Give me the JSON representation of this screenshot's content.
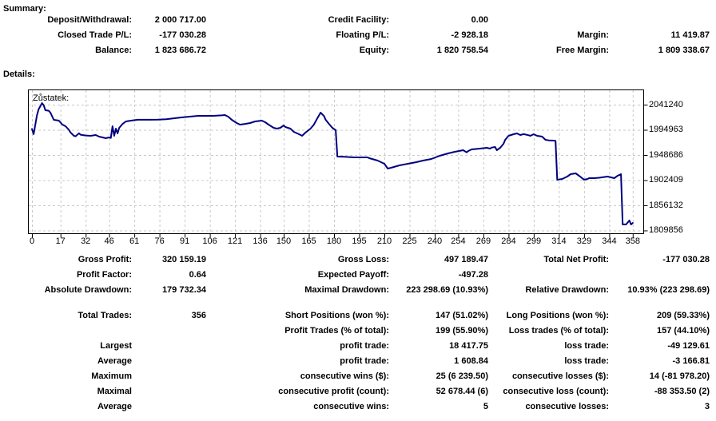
{
  "summary": {
    "heading": "Summary:",
    "rows": [
      {
        "c1l": "Deposit/Withdrawal:",
        "c1v": "2 000 717.00",
        "c2l": "Credit Facility:",
        "c2v": "0.00",
        "c3l": "",
        "c3v": ""
      },
      {
        "c1l": "Closed Trade P/L:",
        "c1v": "-177 030.28",
        "c2l": "Floating P/L:",
        "c2v": "-2 928.18",
        "c3l": "Margin:",
        "c3v": "11 419.87"
      },
      {
        "c1l": "Balance:",
        "c1v": "1 823 686.72",
        "c2l": "Equity:",
        "c2v": "1 820 758.54",
        "c3l": "Free Margin:",
        "c3v": "1 809 338.67"
      }
    ]
  },
  "details": {
    "heading": "Details:",
    "stat_groups": [
      [
        {
          "c1l": "Gross Profit:",
          "c1v": "320 159.19",
          "c2l": "Gross Loss:",
          "c2v": "497 189.47",
          "c3l": "Total Net Profit:",
          "c3v": "-177 030.28"
        },
        {
          "c1l": "Profit Factor:",
          "c1v": "0.64",
          "c2l": "Expected Payoff:",
          "c2v": "-497.28",
          "c3l": "",
          "c3v": ""
        },
        {
          "c1l": "Absolute Drawdown:",
          "c1v": "179 732.34",
          "c2l": "Maximal Drawdown:",
          "c2v": "223 298.69 (10.93%)",
          "c3l": "Relative Drawdown:",
          "c3v": "10.93% (223 298.69)"
        }
      ],
      [
        {
          "c1l": "Total Trades:",
          "c1v": "356",
          "c2l": "Short Positions (won %):",
          "c2v": "147 (51.02%)",
          "c3l": "Long Positions (won %):",
          "c3v": "209 (59.33%)"
        },
        {
          "c1l": "",
          "c1v": "",
          "c2l": "Profit Trades (% of total):",
          "c2v": "199 (55.90%)",
          "c3l": "Loss trades (% of total):",
          "c3v": "157 (44.10%)"
        },
        {
          "c1l": "Largest",
          "c1v": "",
          "c2l": "profit trade:",
          "c2v": "18 417.75",
          "c3l": "loss trade:",
          "c3v": "-49 129.61"
        },
        {
          "c1l": "Average",
          "c1v": "",
          "c2l": "profit trade:",
          "c2v": "1 608.84",
          "c3l": "loss trade:",
          "c3v": "-3 166.81"
        },
        {
          "c1l": "Maximum",
          "c1v": "",
          "c2l": "consecutive wins ($):",
          "c2v": "25 (6 239.50)",
          "c3l": "consecutive losses ($):",
          "c3v": "14 (-81 978.20)"
        },
        {
          "c1l": "Maximal",
          "c1v": "",
          "c2l": "consecutive profit (count):",
          "c2v": "52 678.44 (6)",
          "c3l": "consecutive loss (count):",
          "c3v": "-88 353.50 (2)"
        },
        {
          "c1l": "Average",
          "c1v": "",
          "c2l": "consecutive wins:",
          "c2v": "5",
          "c3l": "consecutive losses:",
          "c3v": "3"
        }
      ]
    ]
  },
  "chart_data": {
    "type": "line",
    "title": "Zůstatek:",
    "series_name": "Balance",
    "line_color": "#000080",
    "grid_color": "#c9c9c9",
    "frame_color": "#000000",
    "legend_position": "none",
    "grid": true,
    "xlabel": "",
    "ylabel": "",
    "x_ticks": [
      0,
      17,
      32,
      46,
      61,
      76,
      91,
      106,
      121,
      136,
      150,
      165,
      180,
      195,
      210,
      225,
      240,
      254,
      269,
      284,
      299,
      314,
      329,
      344,
      358
    ],
    "y_ticks": [
      2041240,
      1994963,
      1948686,
      1902409,
      1856132,
      1809856
    ],
    "xlim": [
      0,
      365
    ],
    "ylim": [
      1804000,
      2069000
    ],
    "points": [
      [
        0,
        1996500
      ],
      [
        1,
        1987000
      ],
      [
        2,
        2004500
      ],
      [
        3,
        2022000
      ],
      [
        4,
        2033000
      ],
      [
        6,
        2044000
      ],
      [
        7,
        2040000
      ],
      [
        8,
        2031000
      ],
      [
        10,
        2030000
      ],
      [
        11,
        2026600
      ],
      [
        13,
        2013300
      ],
      [
        15,
        2012500
      ],
      [
        16,
        2011900
      ],
      [
        18,
        2005000
      ],
      [
        20,
        2001600
      ],
      [
        22,
        1995000
      ],
      [
        23,
        1990000
      ],
      [
        25,
        1984000
      ],
      [
        26,
        1983000
      ],
      [
        28,
        1988500
      ],
      [
        29,
        1986000
      ],
      [
        30,
        1985400
      ],
      [
        32,
        1984500
      ],
      [
        35,
        1983900
      ],
      [
        38,
        1985400
      ],
      [
        40,
        1982500
      ],
      [
        42,
        1981000
      ],
      [
        44,
        1979500
      ],
      [
        46,
        1981000
      ],
      [
        47,
        1980000
      ],
      [
        48,
        2001600
      ],
      [
        49,
        1984000
      ],
      [
        50,
        1997200
      ],
      [
        51,
        1988400
      ],
      [
        52,
        1998600
      ],
      [
        54,
        2005900
      ],
      [
        56,
        2010400
      ],
      [
        59,
        2011900
      ],
      [
        63,
        2013400
      ],
      [
        70,
        2013400
      ],
      [
        75,
        2013800
      ],
      [
        80,
        2014500
      ],
      [
        84,
        2016000
      ],
      [
        89,
        2017700
      ],
      [
        94,
        2019200
      ],
      [
        99,
        2020700
      ],
      [
        103,
        2020700
      ],
      [
        108,
        2020700
      ],
      [
        113,
        2021500
      ],
      [
        115,
        2022100
      ],
      [
        117,
        2019000
      ],
      [
        119,
        2013400
      ],
      [
        122,
        2007400
      ],
      [
        124,
        2004500
      ],
      [
        127,
        2005900
      ],
      [
        130,
        2007400
      ],
      [
        133,
        2010400
      ],
      [
        137,
        2011900
      ],
      [
        139,
        2008900
      ],
      [
        141,
        2004500
      ],
      [
        144,
        1998600
      ],
      [
        146,
        1997100
      ],
      [
        148,
        1998600
      ],
      [
        150,
        2003100
      ],
      [
        151,
        2000100
      ],
      [
        154,
        1997100
      ],
      [
        156,
        1991300
      ],
      [
        159,
        1987000
      ],
      [
        161,
        1984000
      ],
      [
        163,
        1990000
      ],
      [
        166,
        1997100
      ],
      [
        168,
        2004500
      ],
      [
        170,
        2016000
      ],
      [
        172,
        2026600
      ],
      [
        174,
        2020400
      ],
      [
        175,
        2013400
      ],
      [
        177,
        2005900
      ],
      [
        179,
        1998600
      ],
      [
        181,
        1994200
      ],
      [
        182,
        1945800
      ],
      [
        186,
        1945300
      ],
      [
        192,
        1944300
      ],
      [
        200,
        1944300
      ],
      [
        201,
        1942800
      ],
      [
        206,
        1938400
      ],
      [
        208,
        1935500
      ],
      [
        210,
        1932500
      ],
      [
        212,
        1923700
      ],
      [
        214,
        1925200
      ],
      [
        219,
        1929600
      ],
      [
        224,
        1932500
      ],
      [
        229,
        1935500
      ],
      [
        233,
        1938400
      ],
      [
        238,
        1941300
      ],
      [
        243,
        1947200
      ],
      [
        248,
        1951600
      ],
      [
        252,
        1954600
      ],
      [
        257,
        1957500
      ],
      [
        259,
        1953500
      ],
      [
        260,
        1956000
      ],
      [
        262,
        1958900
      ],
      [
        267,
        1960400
      ],
      [
        271,
        1961900
      ],
      [
        273,
        1960400
      ],
      [
        274,
        1962400
      ],
      [
        276,
        1963400
      ],
      [
        277,
        1957500
      ],
      [
        279,
        1961900
      ],
      [
        281,
        1969300
      ],
      [
        282,
        1976600
      ],
      [
        284,
        1983900
      ],
      [
        287,
        1986900
      ],
      [
        289,
        1988400
      ],
      [
        291,
        1985400
      ],
      [
        293,
        1987000
      ],
      [
        296,
        1985000
      ],
      [
        297,
        1983900
      ],
      [
        299,
        1986900
      ],
      [
        301,
        1983900
      ],
      [
        303,
        1983000
      ],
      [
        304,
        1982500
      ],
      [
        306,
        1976600
      ],
      [
        308,
        1975500
      ],
      [
        311,
        1975100
      ],
      [
        312,
        1974500
      ],
      [
        313,
        1903200
      ],
      [
        314,
        1903500
      ],
      [
        316,
        1904600
      ],
      [
        319,
        1909000
      ],
      [
        321,
        1913400
      ],
      [
        324,
        1914900
      ],
      [
        326,
        1910500
      ],
      [
        329,
        1903200
      ],
      [
        331,
        1904500
      ],
      [
        332,
        1906100
      ],
      [
        335,
        1906100
      ],
      [
        338,
        1906800
      ],
      [
        340,
        1907600
      ],
      [
        343,
        1909000
      ],
      [
        345,
        1907500
      ],
      [
        347,
        1906100
      ],
      [
        349,
        1910500
      ],
      [
        351,
        1913400
      ],
      [
        352,
        1820900
      ],
      [
        353,
        1821000
      ],
      [
        354,
        1820900
      ],
      [
        355,
        1824500
      ],
      [
        356,
        1828200
      ],
      [
        357,
        1820900
      ],
      [
        358,
        1823687
      ]
    ]
  }
}
